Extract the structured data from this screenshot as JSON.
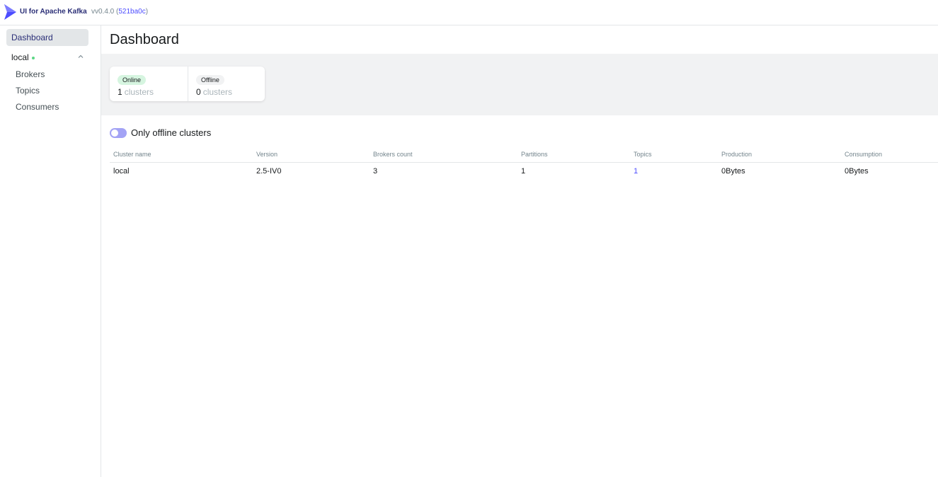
{
  "header": {
    "brand": "UI for Apache Kafka",
    "version": "vv0.4.0",
    "commit": "521ba0c"
  },
  "sidebar": {
    "dashboard": "Dashboard",
    "cluster": "local",
    "items": [
      {
        "label": "Brokers"
      },
      {
        "label": "Topics"
      },
      {
        "label": "Consumers"
      }
    ]
  },
  "main": {
    "title": "Dashboard",
    "metrics": {
      "online_label": "Online",
      "online_count": "1",
      "online_unit": "clusters",
      "offline_label": "Offline",
      "offline_count": "0",
      "offline_unit": "clusters"
    },
    "toggle_label": "Only offline clusters",
    "table": {
      "headers": [
        "Cluster name",
        "Version",
        "Brokers count",
        "Partitions",
        "Topics",
        "Production",
        "Consumption"
      ],
      "rows": [
        [
          "local",
          "2.5-IV0",
          "3",
          "1",
          "1",
          "0Bytes",
          "0Bytes"
        ]
      ]
    }
  },
  "colors": {
    "accent": "#4c4cff",
    "online": "#5cd685"
  }
}
